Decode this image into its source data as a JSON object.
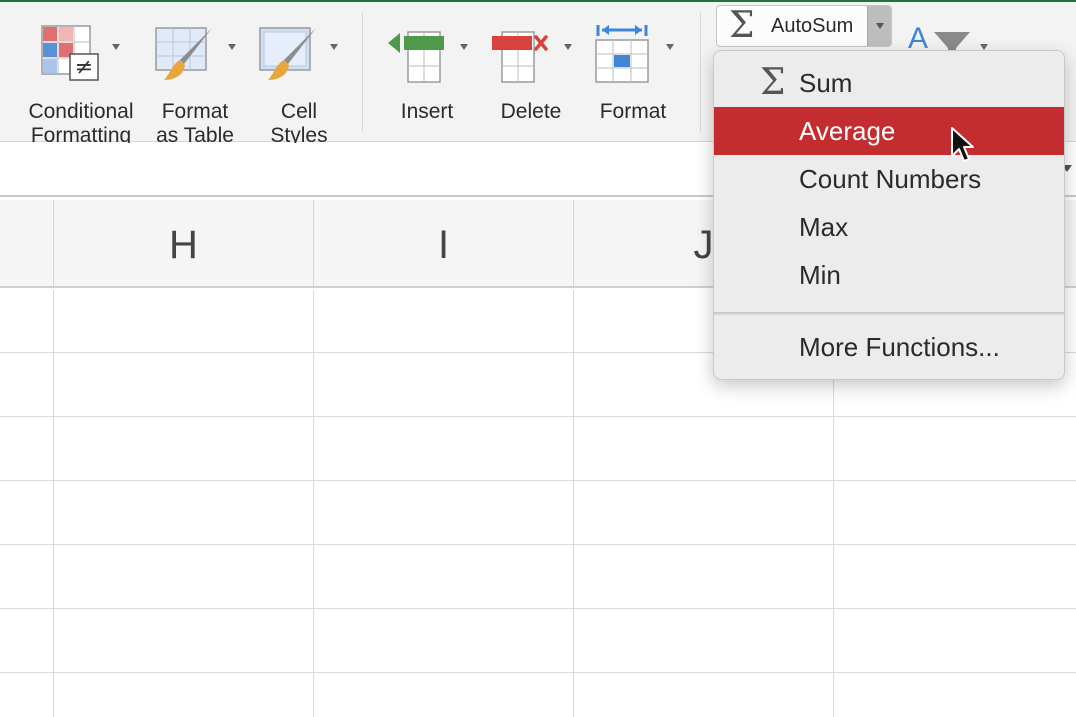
{
  "ribbon": {
    "conditional_formatting": {
      "line1": "Conditional",
      "line2": "Formatting"
    },
    "format_as_table": {
      "line1": "Format",
      "line2": "as Table"
    },
    "cell_styles": {
      "line1": "Cell",
      "line2": "Styles"
    },
    "insert": "Insert",
    "delete": "Delete",
    "format": "Format",
    "autosum": "AutoSum",
    "sigma": "Σ"
  },
  "grid": {
    "columns": [
      "H",
      "I",
      "J"
    ]
  },
  "autosum_menu": {
    "items": [
      {
        "label": "Sum",
        "icon": "sigma-icon",
        "symbol": "Σ"
      },
      {
        "label": "Average",
        "selected": true
      },
      {
        "label": "Count Numbers"
      },
      {
        "label": "Max"
      },
      {
        "label": "Min"
      }
    ],
    "more": "More Functions..."
  },
  "colors": {
    "accent_green": "#1f7244",
    "selection_red": "#c42d2f",
    "insert_green": "#4e9a4a",
    "delete_red": "#d9413d",
    "format_blue": "#3f86d6"
  }
}
